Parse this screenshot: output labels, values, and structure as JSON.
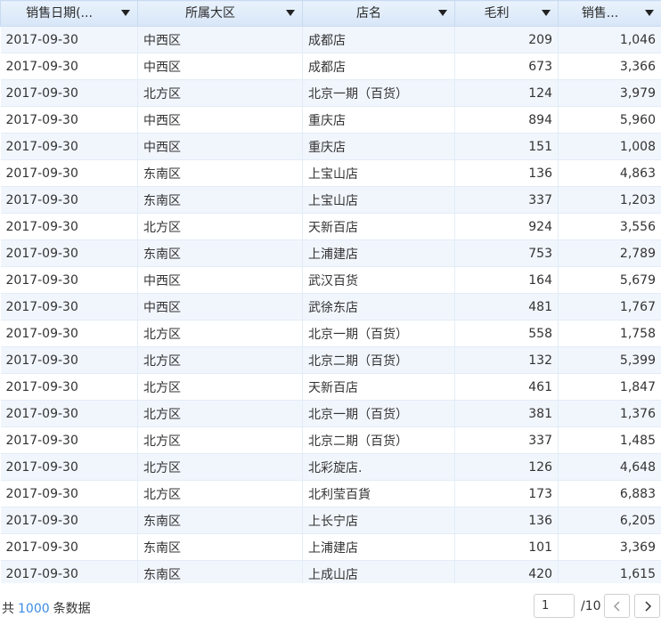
{
  "table": {
    "columns": [
      {
        "label": "销售日期(..."
      },
      {
        "label": "所属大区"
      },
      {
        "label": "店名"
      },
      {
        "label": "毛利"
      },
      {
        "label": "销售..."
      }
    ],
    "rows": [
      [
        "2017-09-30",
        "中西区",
        "成都店",
        "209",
        "1,046"
      ],
      [
        "2017-09-30",
        "中西区",
        "成都店",
        "673",
        "3,366"
      ],
      [
        "2017-09-30",
        "北方区",
        "北京一期（百货）",
        "124",
        "3,979"
      ],
      [
        "2017-09-30",
        "中西区",
        "重庆店",
        "894",
        "5,960"
      ],
      [
        "2017-09-30",
        "中西区",
        "重庆店",
        "151",
        "1,008"
      ],
      [
        "2017-09-30",
        "东南区",
        "上宝山店",
        "136",
        "4,863"
      ],
      [
        "2017-09-30",
        "东南区",
        "上宝山店",
        "337",
        "1,203"
      ],
      [
        "2017-09-30",
        "北方区",
        "天新百店",
        "924",
        "3,556"
      ],
      [
        "2017-09-30",
        "东南区",
        "上浦建店",
        "753",
        "2,789"
      ],
      [
        "2017-09-30",
        "中西区",
        "武汉百货",
        "164",
        "5,679"
      ],
      [
        "2017-09-30",
        "中西区",
        "武徐东店",
        "481",
        "1,767"
      ],
      [
        "2017-09-30",
        "北方区",
        "北京一期（百货）",
        "558",
        "1,758"
      ],
      [
        "2017-09-30",
        "北方区",
        "北京二期（百货）",
        "132",
        "5,399"
      ],
      [
        "2017-09-30",
        "北方区",
        "天新百店",
        "461",
        "1,847"
      ],
      [
        "2017-09-30",
        "北方区",
        "北京一期（百货）",
        "381",
        "1,376"
      ],
      [
        "2017-09-30",
        "北方区",
        "北京二期（百货）",
        "337",
        "1,485"
      ],
      [
        "2017-09-30",
        "北方区",
        "北彩旋店.",
        "126",
        "4,648"
      ],
      [
        "2017-09-30",
        "北方区",
        "北利莹百貨",
        "173",
        "6,883"
      ],
      [
        "2017-09-30",
        "东南区",
        "上长宁店",
        "136",
        "6,205"
      ],
      [
        "2017-09-30",
        "东南区",
        "上浦建店",
        "101",
        "3,369"
      ],
      [
        "2017-09-30",
        "东南区",
        "上成山店",
        "420",
        "1,615"
      ]
    ]
  },
  "footer": {
    "total_prefix": "共",
    "total_count": "1000",
    "total_suffix": "条数据",
    "page_value": "1",
    "page_total": "/10"
  },
  "icons": {
    "sort": "caret-down-icon",
    "prev": "chevron-left-icon",
    "next": "chevron-right-icon"
  },
  "colors": {
    "header_bg": "#dde9f8",
    "row_alt_bg": "#f1f6fd",
    "count_link": "#3b8be6"
  }
}
